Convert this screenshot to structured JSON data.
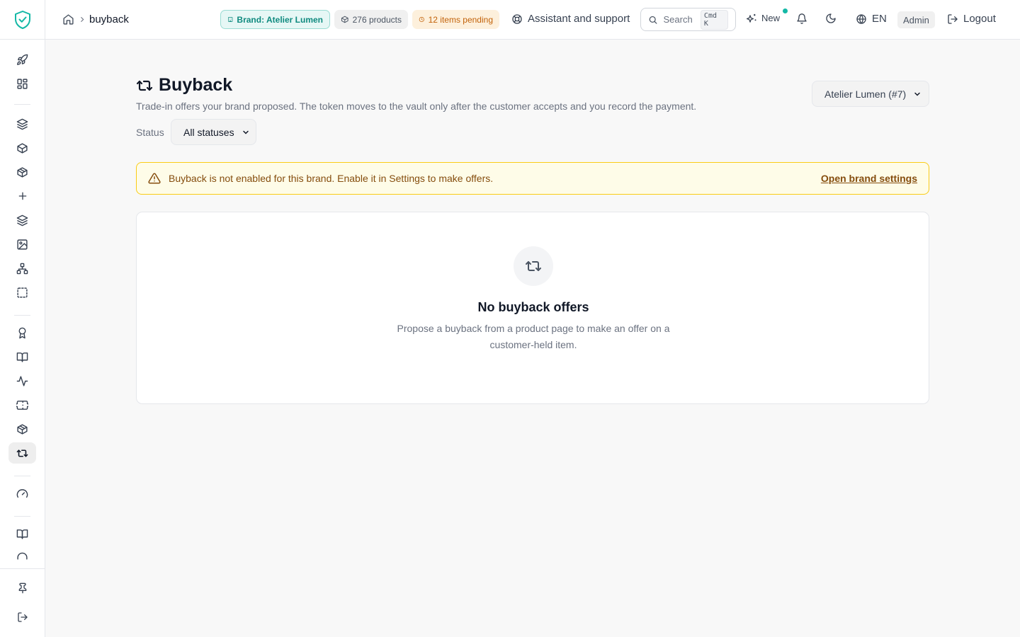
{
  "breadcrumb": {
    "current": "buyback"
  },
  "topbar": {
    "brand_chip": "Brand: Atelier Lumen",
    "products_chip": "276 products",
    "pending_chip": "12 items pending",
    "assistant": "Assistant and support",
    "search_label": "Search",
    "search_shortcut": "Cmd K",
    "new_label": "New",
    "language": "EN",
    "role": "Admin",
    "logout": "Logout"
  },
  "page": {
    "title": "Buyback",
    "subtitle": "Trade-in offers your brand proposed. The token moves to the vault only after the customer accepts and you record the payment.",
    "brand_selector": "Atelier Lumen (#7)",
    "status_label": "Status",
    "status_value": "All statuses"
  },
  "alert": {
    "text": "Buyback is not enabled for this brand. Enable it in Settings to make offers.",
    "link": "Open brand settings"
  },
  "empty_state": {
    "title": "No buyback offers",
    "description": "Propose a buyback from a product page to make an offer on a customer-held item."
  },
  "colors": {
    "accent": "#14b8a6",
    "warning_bg": "#fefce8",
    "warning_border": "#facc15",
    "warning_text": "#854d0e"
  }
}
